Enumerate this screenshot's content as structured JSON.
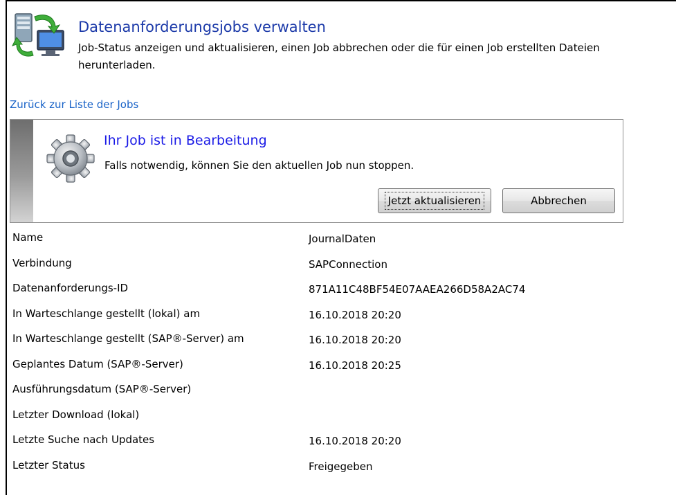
{
  "header": {
    "title": "Datenanforderungsjobs verwalten",
    "subtitle_line1": "Job-Status anzeigen und aktualisieren, einen Job abbrechen oder die für einen Job erstellten Dateien",
    "subtitle_line2": "herunterladen.",
    "icon": "server-sync-icon"
  },
  "nav": {
    "back_link": "Zurück zur Liste der Jobs"
  },
  "status_panel": {
    "icon": "gear-icon",
    "title": "Ihr Job ist in Bearbeitung",
    "message": "Falls notwendig, können Sie den aktuellen Job nun stoppen.",
    "refresh_label": "Jetzt aktualisieren",
    "cancel_label": "Abbrechen"
  },
  "details": [
    {
      "label": "Name",
      "value": "JournalDaten"
    },
    {
      "label": "Verbindung",
      "value": "SAPConnection"
    },
    {
      "label": "Datenanforderungs-ID",
      "value": "871A11C48BF54E07AAEA266D58A2AC74"
    },
    {
      "label": "In Warteschlange gestellt (lokal) am",
      "value": "16.10.2018 20:20"
    },
    {
      "label": "In Warteschlange gestellt (SAP®-Server) am",
      "value": "16.10.2018 20:20"
    },
    {
      "label": "Geplantes Datum (SAP®-Server)",
      "value": "16.10.2018 20:25"
    },
    {
      "label": "Ausführungsdatum (SAP®-Server)",
      "value": ""
    },
    {
      "label": "Letzter Download (lokal)",
      "value": ""
    },
    {
      "label": "Letzte Suche nach Updates",
      "value": "16.10.2018 20:20"
    },
    {
      "label": "Letzter Status",
      "value": "Freigegeben"
    }
  ],
  "colors": {
    "title": "#1c3aa9",
    "link": "#1b64c8",
    "panel_title": "#1a1ae6"
  }
}
